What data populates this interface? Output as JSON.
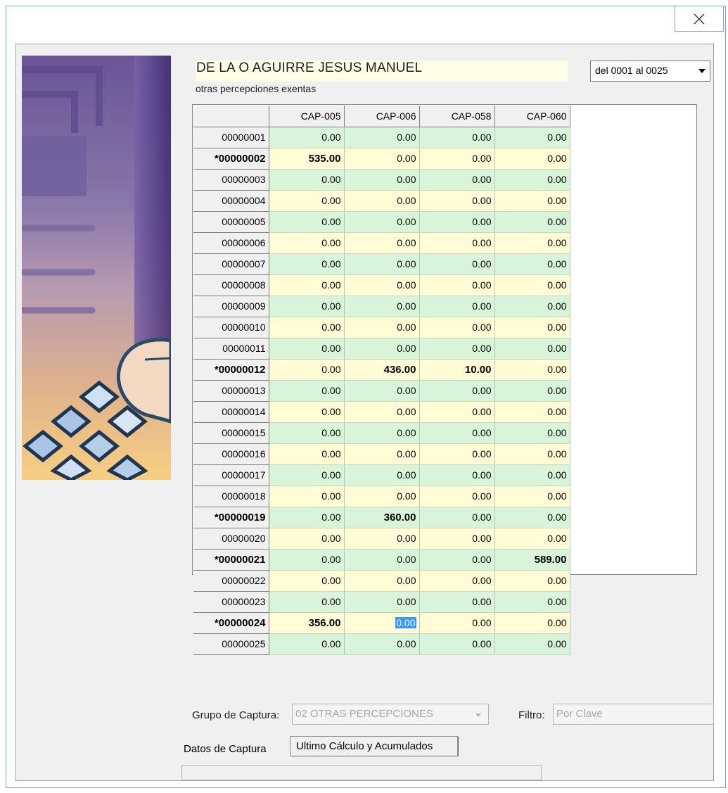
{
  "window": {
    "close_label": ""
  },
  "header": {
    "employee_name": "DE LA O AGUIRRE JESUS MANUEL",
    "subtitle": "otras percepciones exentas",
    "range_select_value": "del 0001 al 0025"
  },
  "grid": {
    "columns": [
      "CAP-005",
      "CAP-006",
      "CAP-058",
      "CAP-060"
    ],
    "rows": [
      {
        "key": "00000001",
        "modified": false,
        "values": [
          "0.00",
          "0.00",
          "0.00",
          "0.00"
        ],
        "bold": [
          false,
          false,
          false,
          false
        ]
      },
      {
        "key": "*00000002",
        "modified": true,
        "values": [
          "535.00",
          "0.00",
          "0.00",
          "0.00"
        ],
        "bold": [
          true,
          false,
          false,
          false
        ]
      },
      {
        "key": "00000003",
        "modified": false,
        "values": [
          "0.00",
          "0.00",
          "0.00",
          "0.00"
        ],
        "bold": [
          false,
          false,
          false,
          false
        ]
      },
      {
        "key": "00000004",
        "modified": false,
        "values": [
          "0.00",
          "0.00",
          "0.00",
          "0.00"
        ],
        "bold": [
          false,
          false,
          false,
          false
        ]
      },
      {
        "key": "00000005",
        "modified": false,
        "values": [
          "0.00",
          "0.00",
          "0.00",
          "0.00"
        ],
        "bold": [
          false,
          false,
          false,
          false
        ]
      },
      {
        "key": "00000006",
        "modified": false,
        "values": [
          "0.00",
          "0.00",
          "0.00",
          "0.00"
        ],
        "bold": [
          false,
          false,
          false,
          false
        ]
      },
      {
        "key": "00000007",
        "modified": false,
        "values": [
          "0.00",
          "0.00",
          "0.00",
          "0.00"
        ],
        "bold": [
          false,
          false,
          false,
          false
        ]
      },
      {
        "key": "00000008",
        "modified": false,
        "values": [
          "0.00",
          "0.00",
          "0.00",
          "0.00"
        ],
        "bold": [
          false,
          false,
          false,
          false
        ]
      },
      {
        "key": "00000009",
        "modified": false,
        "values": [
          "0.00",
          "0.00",
          "0.00",
          "0.00"
        ],
        "bold": [
          false,
          false,
          false,
          false
        ]
      },
      {
        "key": "00000010",
        "modified": false,
        "values": [
          "0.00",
          "0.00",
          "0.00",
          "0.00"
        ],
        "bold": [
          false,
          false,
          false,
          false
        ]
      },
      {
        "key": "00000011",
        "modified": false,
        "values": [
          "0.00",
          "0.00",
          "0.00",
          "0.00"
        ],
        "bold": [
          false,
          false,
          false,
          false
        ]
      },
      {
        "key": "*00000012",
        "modified": true,
        "values": [
          "0.00",
          "436.00",
          "10.00",
          "0.00"
        ],
        "bold": [
          false,
          true,
          true,
          false
        ]
      },
      {
        "key": "00000013",
        "modified": false,
        "values": [
          "0.00",
          "0.00",
          "0.00",
          "0.00"
        ],
        "bold": [
          false,
          false,
          false,
          false
        ]
      },
      {
        "key": "00000014",
        "modified": false,
        "values": [
          "0.00",
          "0.00",
          "0.00",
          "0.00"
        ],
        "bold": [
          false,
          false,
          false,
          false
        ]
      },
      {
        "key": "00000015",
        "modified": false,
        "values": [
          "0.00",
          "0.00",
          "0.00",
          "0.00"
        ],
        "bold": [
          false,
          false,
          false,
          false
        ]
      },
      {
        "key": "00000016",
        "modified": false,
        "values": [
          "0.00",
          "0.00",
          "0.00",
          "0.00"
        ],
        "bold": [
          false,
          false,
          false,
          false
        ]
      },
      {
        "key": "00000017",
        "modified": false,
        "values": [
          "0.00",
          "0.00",
          "0.00",
          "0.00"
        ],
        "bold": [
          false,
          false,
          false,
          false
        ]
      },
      {
        "key": "00000018",
        "modified": false,
        "values": [
          "0.00",
          "0.00",
          "0.00",
          "0.00"
        ],
        "bold": [
          false,
          false,
          false,
          false
        ]
      },
      {
        "key": "*00000019",
        "modified": true,
        "values": [
          "0.00",
          "360.00",
          "0.00",
          "0.00"
        ],
        "bold": [
          false,
          true,
          false,
          false
        ]
      },
      {
        "key": "00000020",
        "modified": false,
        "values": [
          "0.00",
          "0.00",
          "0.00",
          "0.00"
        ],
        "bold": [
          false,
          false,
          false,
          false
        ]
      },
      {
        "key": "*00000021",
        "modified": true,
        "values": [
          "0.00",
          "0.00",
          "0.00",
          "589.00"
        ],
        "bold": [
          false,
          false,
          false,
          true
        ]
      },
      {
        "key": "00000022",
        "modified": false,
        "values": [
          "0.00",
          "0.00",
          "0.00",
          "0.00"
        ],
        "bold": [
          false,
          false,
          false,
          false
        ]
      },
      {
        "key": "00000023",
        "modified": false,
        "values": [
          "0.00",
          "0.00",
          "0.00",
          "0.00"
        ],
        "bold": [
          false,
          false,
          false,
          false
        ]
      },
      {
        "key": "*00000024",
        "modified": true,
        "values": [
          "356.00",
          "0.00",
          "0.00",
          "0.00"
        ],
        "bold": [
          true,
          false,
          false,
          false
        ]
      },
      {
        "key": "00000025",
        "modified": false,
        "values": [
          "0.00",
          "0.00",
          "0.00",
          "0.00"
        ],
        "bold": [
          false,
          false,
          false,
          false
        ]
      }
    ],
    "selected_cell": {
      "row": 23,
      "col": 1
    },
    "row_colors": {
      "even": "#d9f5d9",
      "odd": "#fffcd6"
    },
    "selection_color": "#3399ff"
  },
  "footer": {
    "grupo_label": "Grupo de Captura:",
    "grupo_value": "02 OTRAS PERCEPCIONES",
    "filtro_label": "Filtro:",
    "filtro_placeholder": "Por Clave"
  },
  "tabs": [
    {
      "label": "Datos de Captura",
      "active": true
    },
    {
      "label": "Ultimo Cálculo y Acumulados",
      "active": false
    }
  ],
  "icons": {
    "close": "close-icon",
    "dropdown": "chevron-down-icon"
  }
}
